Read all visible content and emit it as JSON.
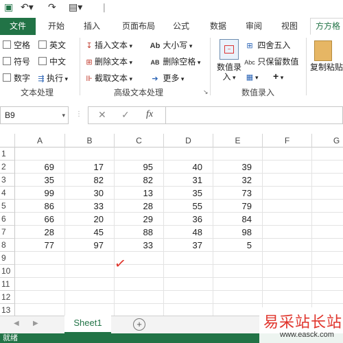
{
  "qat": {
    "icons": [
      "save-icon",
      "undo-icon",
      "redo-icon",
      "customize-icon"
    ]
  },
  "tabs": [
    {
      "label": "文件"
    },
    {
      "label": "开始"
    },
    {
      "label": "插入"
    },
    {
      "label": "页面布局"
    },
    {
      "label": "公式"
    },
    {
      "label": "数据"
    },
    {
      "label": "审阅"
    },
    {
      "label": "视图"
    },
    {
      "label": "方方格"
    }
  ],
  "ribbon": {
    "text_group": {
      "items": [
        "空格",
        "英文",
        "符号",
        "中文",
        "数字",
        "执行"
      ],
      "label": "文本处理"
    },
    "adv_group": {
      "items": [
        "插入文本",
        "删除文本",
        "截取文本",
        "大小写",
        "删除空格",
        "更多"
      ],
      "label": "高级文本处理"
    },
    "num_group": {
      "big_button": "数值录入",
      "items": [
        "四舍五入",
        "只保留数值"
      ],
      "label": "数值录入",
      "plus": "+"
    },
    "copy_paste": "复制粘贴"
  },
  "formula_bar": {
    "name_box": "B9",
    "cancel": "✕",
    "confirm": "✓",
    "fx": "fx",
    "value": ""
  },
  "grid": {
    "columns": [
      "A",
      "B",
      "C",
      "D",
      "E",
      "F",
      "G"
    ],
    "rows": [
      "1",
      "2",
      "3",
      "4",
      "5",
      "6",
      "7",
      "8",
      "9",
      "10",
      "11",
      "12",
      "13"
    ],
    "data": [
      [
        69,
        17,
        95,
        40,
        39
      ],
      [
        35,
        82,
        82,
        31,
        32
      ],
      [
        99,
        30,
        13,
        35,
        73
      ],
      [
        86,
        33,
        28,
        55,
        79
      ],
      [
        66,
        20,
        29,
        36,
        84
      ],
      [
        28,
        45,
        88,
        48,
        98
      ],
      [
        77,
        97,
        33,
        37,
        5
      ]
    ],
    "annotation": "✓"
  },
  "sheets": {
    "tabs": [
      "Sheet1"
    ],
    "add": "+"
  },
  "status": {
    "text": "就绪"
  },
  "watermark": {
    "title": "易采站长站",
    "url": "www.easck.com"
  },
  "colors": {
    "accent": "#217346",
    "check_mark": "#e0342b"
  }
}
